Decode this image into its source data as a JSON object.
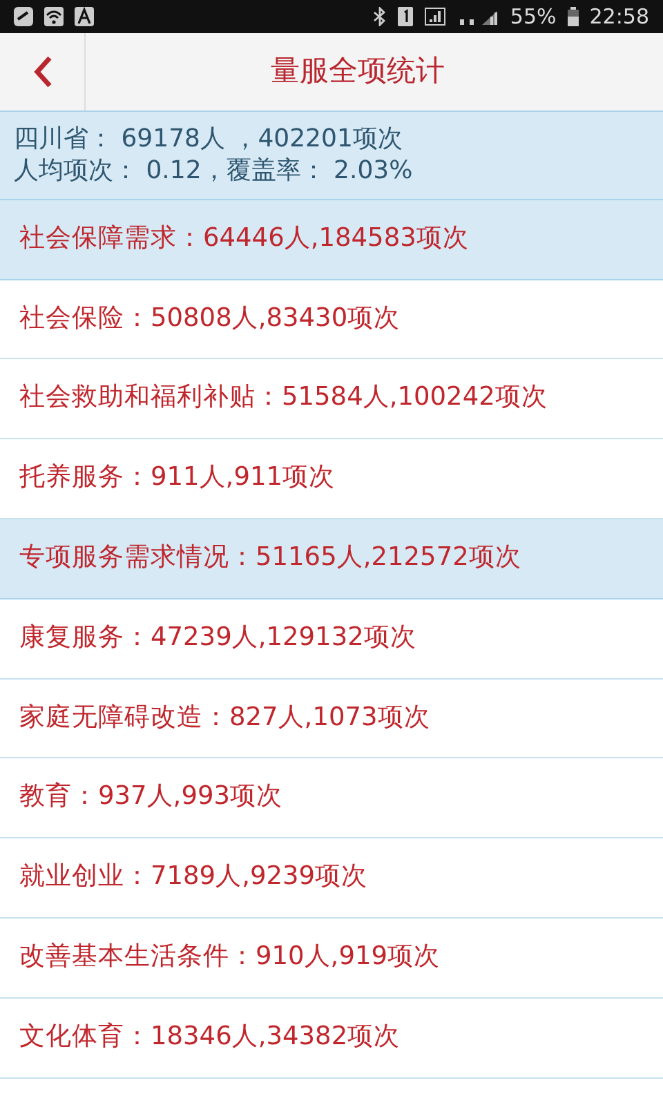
{
  "status_bar": {
    "battery": "55%",
    "time": "22:58"
  },
  "header": {
    "title": "量服全项统计"
  },
  "summary": {
    "lines": [
      "四川省： 69178人 ，402201项次",
      "人均项次： 0.12，覆盖率： 2.03%"
    ]
  },
  "rows": [
    {
      "kind": "category",
      "text": "社会保障需求：64446人,184583项次"
    },
    {
      "kind": "item",
      "text": "社会保险：50808人,83430项次"
    },
    {
      "kind": "item",
      "text": "社会救助和福利补贴：51584人,100242项次"
    },
    {
      "kind": "item",
      "text": "托养服务：911人,911项次"
    },
    {
      "kind": "category",
      "text": "专项服务需求情况：51165人,212572项次"
    },
    {
      "kind": "item",
      "text": "康复服务：47239人,129132项次"
    },
    {
      "kind": "item",
      "text": "家庭无障碍改造：827人,1073项次"
    },
    {
      "kind": "item",
      "text": "教育：937人,993项次"
    },
    {
      "kind": "item",
      "text": "就业创业：7189人,9239项次"
    },
    {
      "kind": "item",
      "text": "改善基本生活条件：910人,919项次"
    },
    {
      "kind": "item",
      "text": "文化体育：18346人,34382项次"
    }
  ]
}
